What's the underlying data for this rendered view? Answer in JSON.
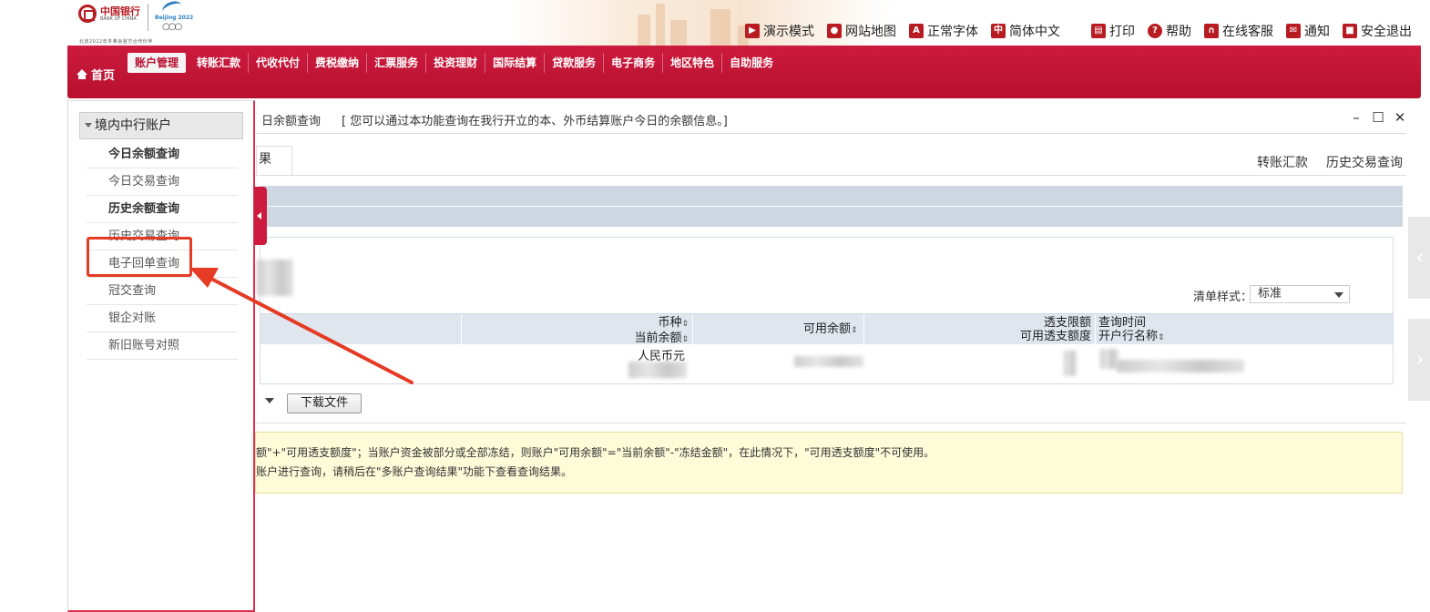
{
  "header": {
    "bank_name": "中国银行",
    "bank_name_en": "BANK OF CHINA",
    "olympic_label": "Beijing 2022",
    "partner_text": "北京2022年冬奥会官方合作伙伴",
    "utility": [
      {
        "icon": "presentation-icon",
        "label": "演示模式"
      },
      {
        "icon": "location-pin-icon",
        "label": "网站地图"
      },
      {
        "icon": "font-a-icon",
        "label": "正常字体"
      },
      {
        "icon": "chinese-char-icon",
        "label": "简体中文"
      },
      {
        "icon": "printer-icon",
        "label": "打印"
      },
      {
        "icon": "help-icon",
        "label": "帮助"
      },
      {
        "icon": "headset-icon",
        "label": "在线客服"
      },
      {
        "icon": "mail-icon",
        "label": "通知"
      },
      {
        "icon": "lock-icon",
        "label": "安全退出"
      }
    ]
  },
  "nav": {
    "home": "首页",
    "items": [
      "账户管理",
      "转账汇款",
      "代收代付",
      "费税缴纳",
      "汇票服务",
      "投资理财",
      "国际结算",
      "贷款服务",
      "电子商务",
      "地区特色",
      "自助服务"
    ],
    "active_index": 0
  },
  "sidebar": {
    "group": "境内中行账户",
    "items": [
      {
        "label": "今日余额查询",
        "bold": true
      },
      {
        "label": "今日交易查询",
        "bold": false
      },
      {
        "label": "历史余额查询",
        "bold": true
      },
      {
        "label": "历史交易查询",
        "bold": false
      },
      {
        "label": "电子回单查询",
        "bold": false
      },
      {
        "label": "冠交查询",
        "bold": false
      },
      {
        "label": "银企对账",
        "bold": false
      },
      {
        "label": "新旧账号对照",
        "bold": false
      }
    ]
  },
  "main": {
    "title": "日余额查询",
    "description": "[ 您可以通过本功能查询在我行开立的本、外币结算账户今日的余额信息。]",
    "tab_result": "果",
    "links": [
      "转账汇款",
      "历史交易查询"
    ],
    "list_style_label": "清单样式：",
    "list_style_value": "标准",
    "table": {
      "headers": {
        "col1_line1": "币种",
        "col1_line2": "当前余额",
        "col2": "可用余额",
        "col3_line1": "透支限额",
        "col3_line2": "可用透支额度",
        "col4_line1": "查询时间",
        "col4_line2": "开户行名称"
      },
      "sort_glyph": "⇕",
      "row_currency": "人民币元"
    },
    "download_button": "下载文件",
    "notice_line1": "额\"+\"可用透支额度\"；当账户资金被部分或全部冻结，则账户\"可用余额\"=\"当前余额\"-\"冻结金额\"，在此情况下，\"可用透支额度\"不可使用。",
    "notice_line2": "账户进行查询，请稍后在\"多账户查询结果\"功能下查看查询结果。"
  },
  "window_controls": [
    "–",
    "☐",
    "✕"
  ],
  "colors": {
    "brand_red": "#c41230",
    "annotation_red": "#e53a24",
    "header_blue": "#cdd7e1",
    "notice_yellow": "#fdfbd8"
  }
}
